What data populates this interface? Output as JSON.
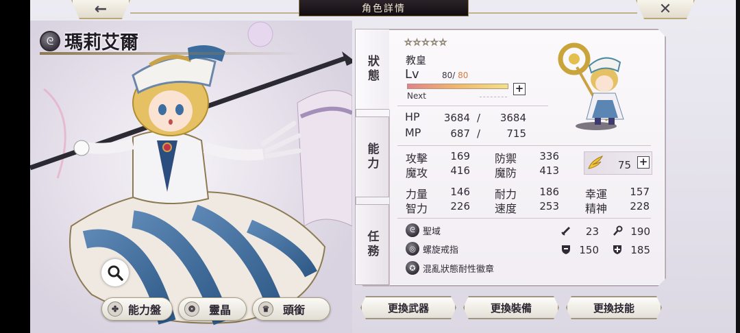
{
  "header": {
    "back_icon": "←",
    "title": "角色詳情",
    "close_icon": "✕"
  },
  "character": {
    "name": "瑪莉艾爾",
    "element_icon": "ᘓ"
  },
  "left_buttons": {
    "zoom_icon": "🔍",
    "ability_board": "能力盤",
    "crystal": "靈晶",
    "title": "頭銜"
  },
  "tabs": [
    "狀態",
    "能力",
    "任務"
  ],
  "status": {
    "stars": "☆☆☆☆☆",
    "job": "教皇",
    "lv_label": "Lv",
    "lv_current": "80",
    "lv_sep": "/",
    "lv_max": "80",
    "exp_fraction": 1.0,
    "next_label": "Next",
    "plus": "+",
    "hp_label": "HP",
    "hp_current": "3684",
    "hp_max": "3684",
    "mp_label": "MP",
    "mp_current": "687",
    "mp_max": "715",
    "slash": "/"
  },
  "stats": {
    "atk_label": "攻擊",
    "atk": "169",
    "def_label": "防禦",
    "def": "336",
    "matk_label": "魔攻",
    "matk": "416",
    "mdef_label": "魔防",
    "mdef": "413",
    "wing_value": "75",
    "str_label": "力量",
    "str": "146",
    "vit_label": "耐力",
    "vit": "186",
    "luk_label": "幸運",
    "luk": "157",
    "int_label": "智力",
    "int": "226",
    "agi_label": "速度",
    "agi": "253",
    "spi_label": "精神",
    "spi": "228"
  },
  "equipment": {
    "weapon": "聖域",
    "ring": "螺旋戒指",
    "badge": "混亂狀態耐性徽章",
    "atk_bonus": "23",
    "matk_bonus": "190",
    "def_bonus": "150",
    "mdef_bonus": "185"
  },
  "actions": {
    "change_weapon": "更換武器",
    "change_gear": "更換裝備",
    "change_skill": "更換技能"
  },
  "colors": {
    "panel_border": "#b9aab6",
    "gold": "#b9a775",
    "lv_max": "#d97a3a"
  }
}
